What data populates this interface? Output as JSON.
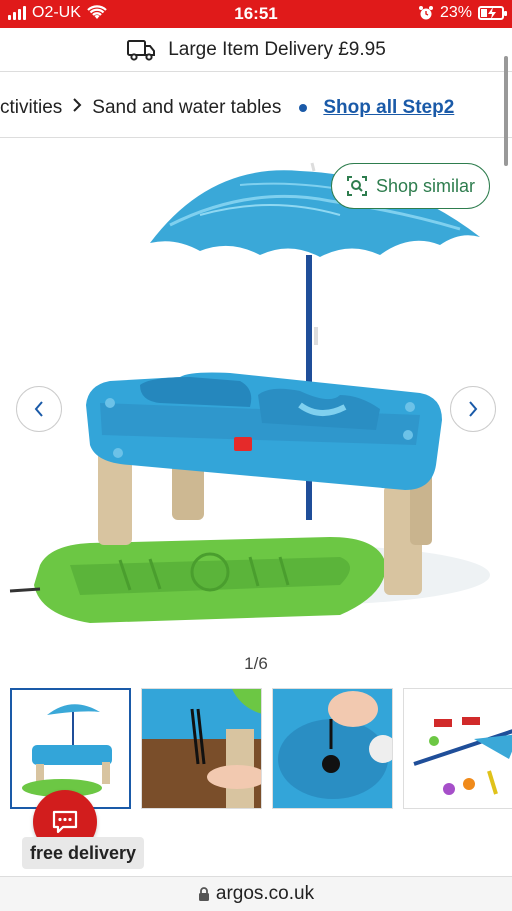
{
  "status_bar": {
    "carrier": "O2-UK",
    "time": "16:51",
    "battery": "23%",
    "battery_level": 0.23
  },
  "delivery_banner": {
    "text": "Large Item Delivery £9.95",
    "icon": "truck-icon"
  },
  "breadcrumb": {
    "items": [
      "ctivities",
      "Sand and water tables"
    ],
    "link": "Shop all Step2"
  },
  "gallery": {
    "shop_similar_label": "Shop similar",
    "counter": "1/6",
    "thumbnails": [
      "table-with-umbrella",
      "table-corner-detail",
      "hand-on-plug",
      "accessories"
    ]
  },
  "badges": {
    "free_delivery": "free delivery"
  },
  "url_bar": {
    "domain": "argos.co.uk"
  },
  "colors": {
    "status_bar": "#e01a1a",
    "link_blue": "#1a5aa8",
    "shop_similar_green": "#2e7d4e",
    "chat_red": "#d21d1d"
  }
}
